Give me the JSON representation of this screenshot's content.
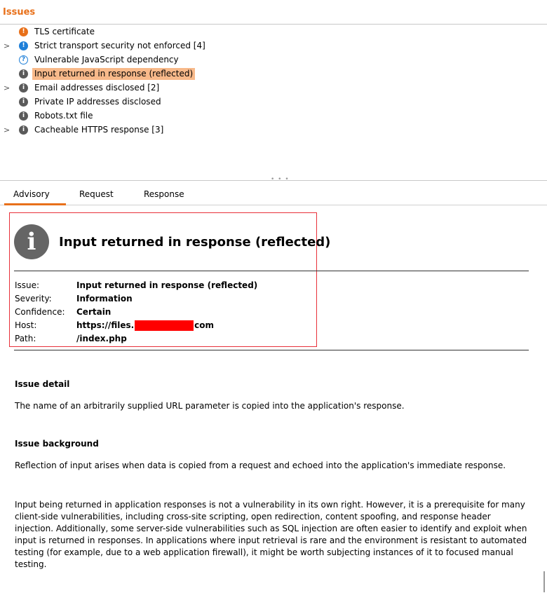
{
  "issues_title": "Issues",
  "tree": [
    {
      "label": "TLS certificate",
      "icon": "high-severity-icon",
      "expander": false,
      "selected": false
    },
    {
      "label": "Strict transport security not enforced [4]",
      "icon": "medium-severity-icon",
      "expander": true,
      "selected": false
    },
    {
      "label": "Vulnerable JavaScript dependency",
      "icon": "tentative-icon",
      "expander": false,
      "selected": false
    },
    {
      "label": "Input returned in response (reflected)",
      "icon": "info-icon",
      "expander": false,
      "selected": true
    },
    {
      "label": "Email addresses disclosed [2]",
      "icon": "info-icon",
      "expander": true,
      "selected": false
    },
    {
      "label": "Private IP addresses disclosed",
      "icon": "info-icon",
      "expander": false,
      "selected": false
    },
    {
      "label": "Robots.txt file",
      "icon": "info-icon",
      "expander": false,
      "selected": false
    },
    {
      "label": "Cacheable HTTPS response [3]",
      "icon": "info-icon",
      "expander": true,
      "selected": false
    }
  ],
  "tabs": [
    "Advisory",
    "Request",
    "Response"
  ],
  "advisory": {
    "title": "Input returned in response (reflected)",
    "fields": [
      {
        "key": "Issue:",
        "value": "Input returned in response (reflected)"
      },
      {
        "key": "Severity:",
        "value": "Information"
      },
      {
        "key": "Confidence:",
        "value": "Certain"
      },
      {
        "key": "Host:",
        "value_prefix": "https://files.",
        "value_suffix": "com"
      },
      {
        "key": "Path:",
        "value": "/index.php"
      }
    ],
    "detail_heading": "Issue detail",
    "detail_text": "The name of an arbitrarily supplied URL parameter is copied into the application's response.",
    "background_heading": "Issue background",
    "background_p1": "Reflection of input arises when data is copied from a request and echoed into the application's immediate response.",
    "background_p2": "Input being returned in application responses is not a vulnerability in its own right. However, it is a prerequisite for many client-side vulnerabilities, including cross-site scripting, open redirection, content spoofing, and response header injection. Additionally, some server-side vulnerabilities such as SQL injection are often easier to identify and exploit when input is returned in responses. In applications where input retrieval is rare and the environment is resistant to automated testing (for example, due to a web application firewall), it might be worth subjecting instances of it to focused manual testing."
  },
  "colors": {
    "accent": "#e8701a",
    "selected_bg": "#f8b98a",
    "annotation_box": "#e8303a"
  }
}
